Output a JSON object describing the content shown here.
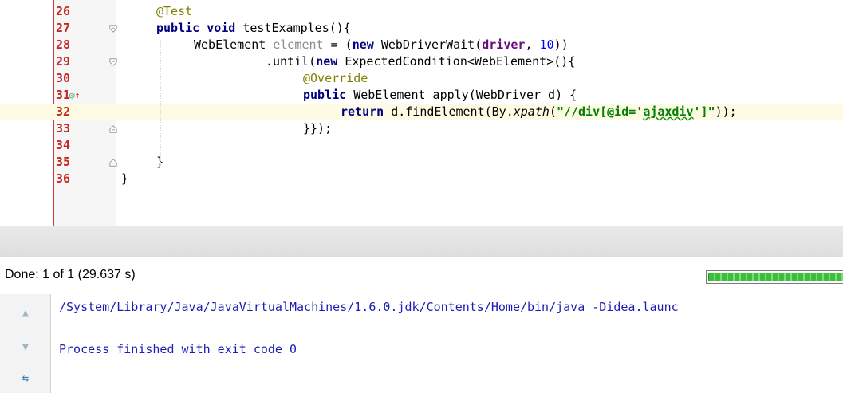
{
  "editor": {
    "lines": [
      {
        "num": "26",
        "code": "@Test"
      },
      {
        "num": "27",
        "code": "public void testExamples(){"
      },
      {
        "num": "28",
        "code": "WebElement element = (new WebDriverWait(driver, 10))"
      },
      {
        "num": "29",
        "code": ".until(new ExpectedCondition<WebElement>(){"
      },
      {
        "num": "30",
        "code": "@Override"
      },
      {
        "num": "31",
        "code": "public WebElement apply(WebDriver d) {",
        "gutter_icon": "override-implements-icon"
      },
      {
        "num": "32",
        "code": "return d.findElement(By.xpath(\"//div[@id='ajaxdiv']\"));"
      },
      {
        "num": "33",
        "code": "}});"
      },
      {
        "num": "34",
        "code": ""
      },
      {
        "num": "35",
        "code": "}"
      },
      {
        "num": "36",
        "code": "}"
      }
    ]
  },
  "run_panel": {
    "status": "Done: 1 of 1 (29.637 s)",
    "progress_fraction": 1.0,
    "console": [
      "/System/Library/Java/JavaVirtualMachines/1.6.0.jdk/Contents/Home/bin/java -Didea.launc",
      "Process finished with exit code 0"
    ],
    "tools": [
      "up-arrow-icon",
      "down-arrow-icon",
      "soft-wrap-icon"
    ]
  },
  "colors": {
    "keyword": "#000080",
    "annotation": "#808000",
    "string": "#008000",
    "line_number": "#c62828",
    "console_text": "#1c1cb4",
    "progress": "#3bbf3b"
  }
}
